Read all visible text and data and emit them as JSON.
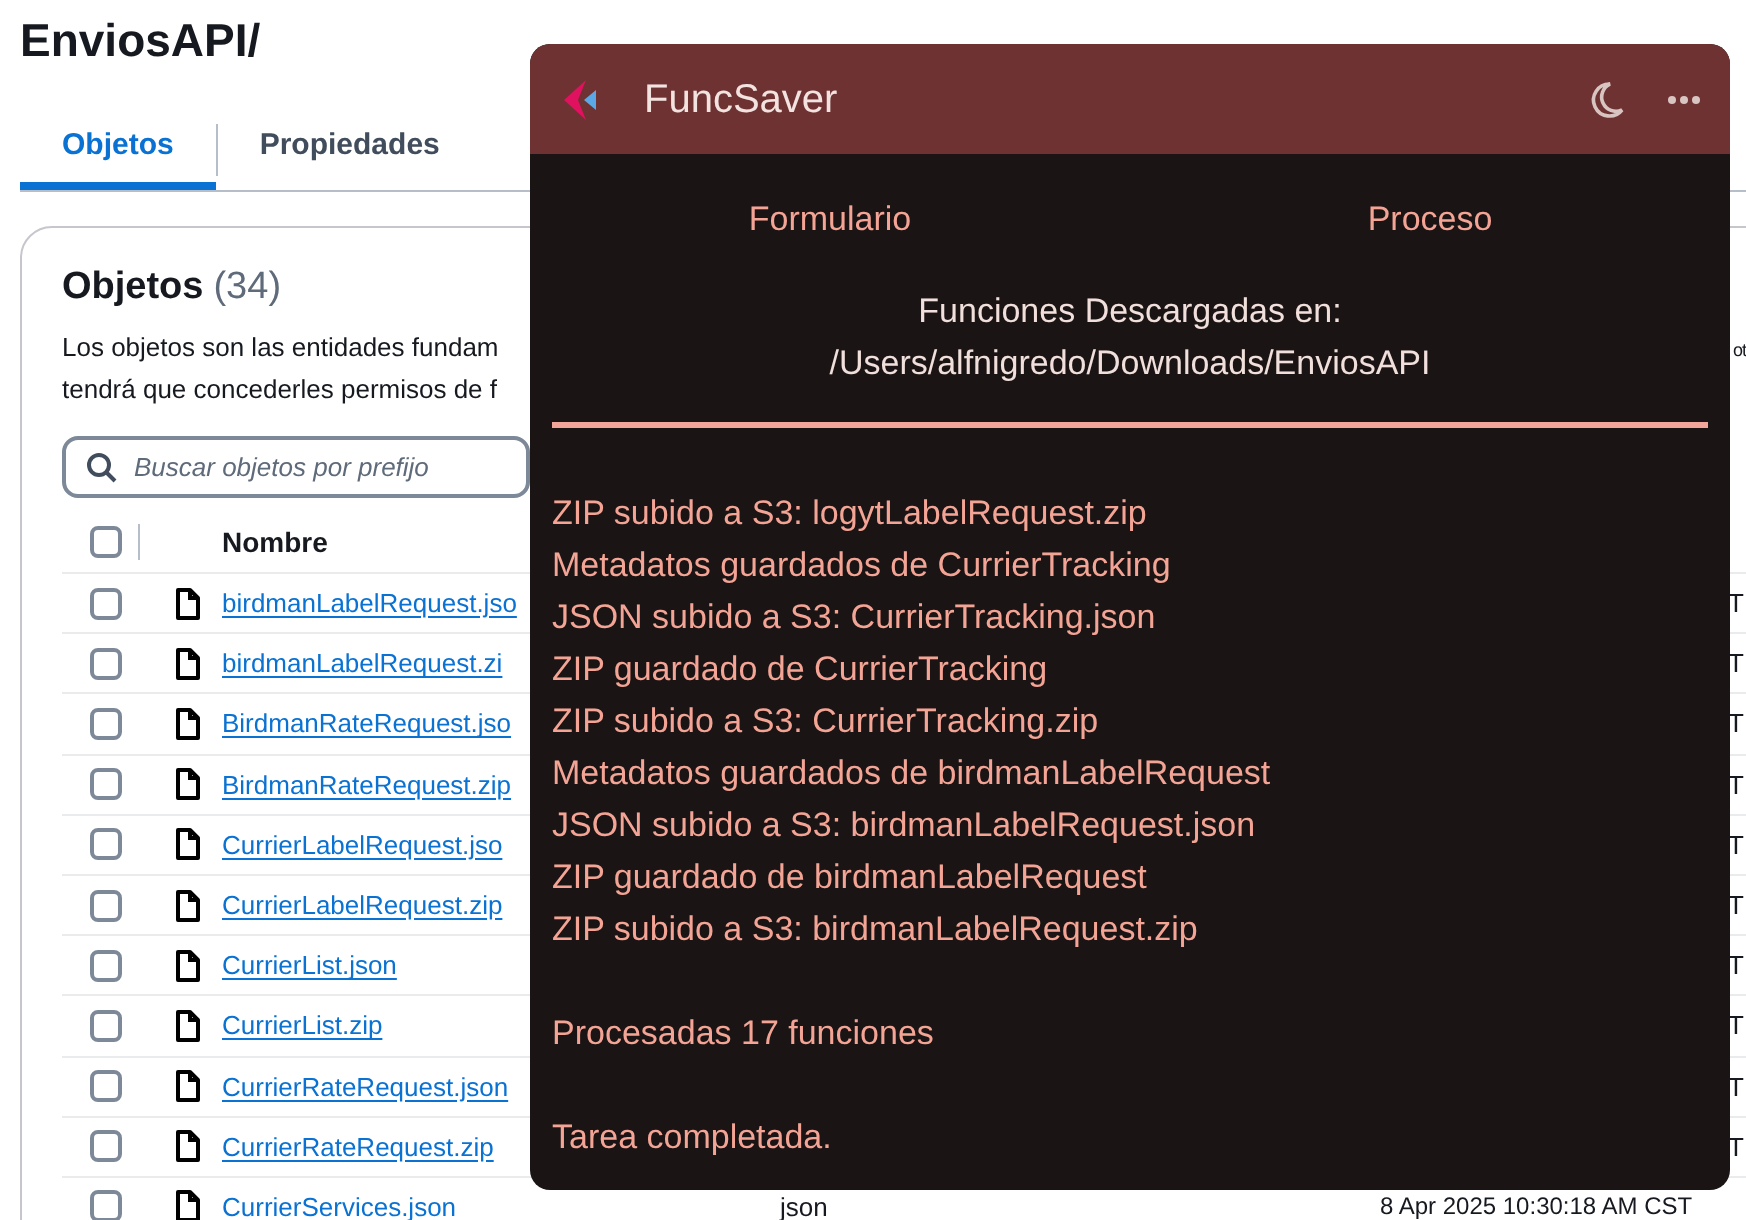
{
  "page": {
    "title": "EnviosAPI/"
  },
  "tabs": [
    {
      "label": "Objetos",
      "selected": true
    },
    {
      "label": "Propiedades",
      "selected": false
    }
  ],
  "panel": {
    "title": "Objetos",
    "count": "(34)",
    "description_lines": [
      {
        "text": "Los objetos son las entidades fundam",
        "tail": "ot"
      },
      {
        "text": "tendrá que concederles permisos de f"
      }
    ],
    "search": {
      "placeholder": "Buscar objetos por prefijo"
    },
    "select_all": {
      "checked": false
    },
    "columns": [
      {
        "label": "Nombre"
      }
    ],
    "rows": [
      {
        "name": "birdmanLabelRequest.jso",
        "column_3": "T",
        "checked": false
      },
      {
        "name": "birdmanLabelRequest.zi",
        "column_3": "T",
        "checked": false
      },
      {
        "name": "BirdmanRateRequest.jso",
        "column_3": "T",
        "checked": false
      },
      {
        "name": "BirdmanRateRequest.zip",
        "column_3": "T",
        "checked": false
      },
      {
        "name": "CurrierLabelRequest.jso",
        "column_3": "T",
        "checked": false
      },
      {
        "name": "CurrierLabelRequest.zip",
        "column_3": "T",
        "checked": false
      },
      {
        "name": "CurrierList.json",
        "column_3": "T",
        "checked": false
      },
      {
        "name": "CurrierList.zip",
        "column_3": "T",
        "checked": false
      },
      {
        "name": "CurrierRateRequest.json",
        "column_3": "T",
        "checked": false
      },
      {
        "name": "CurrierRateRequest.zip",
        "column_3": "T",
        "checked": false
      },
      {
        "name": "CurrierServices.json",
        "type": "json",
        "date": "8 Apr 2025 10:30:18 AM CST",
        "checked": false
      }
    ]
  },
  "app": {
    "title": "FuncSaver",
    "nav": [
      {
        "label": "Formulario"
      },
      {
        "label": "Proceso"
      }
    ],
    "download_heading": "Funciones Descargadas en:",
    "download_path": "/Users/alfnigredo/Downloads/EnviosAPI",
    "log": [
      {
        "text": "ZIP subido a S3: logytLabelRequest.zip"
      },
      {
        "text": "Metadatos guardados de CurrierTracking"
      },
      {
        "text": "JSON subido a S3: CurrierTracking.json"
      },
      {
        "text": "ZIP guardado de CurrierTracking"
      },
      {
        "text": "ZIP subido a S3: CurrierTracking.zip"
      },
      {
        "text": "Metadatos guardados de birdmanLabelRequest"
      },
      {
        "text": "JSON subido a S3: birdmanLabelRequest.json"
      },
      {
        "text": "ZIP guardado de birdmanLabelRequest"
      },
      {
        "text": "ZIP subido a S3: birdmanLabelRequest.zip"
      }
    ],
    "summary": "Procesadas 17 funciones",
    "status": "Tarea completada."
  }
}
